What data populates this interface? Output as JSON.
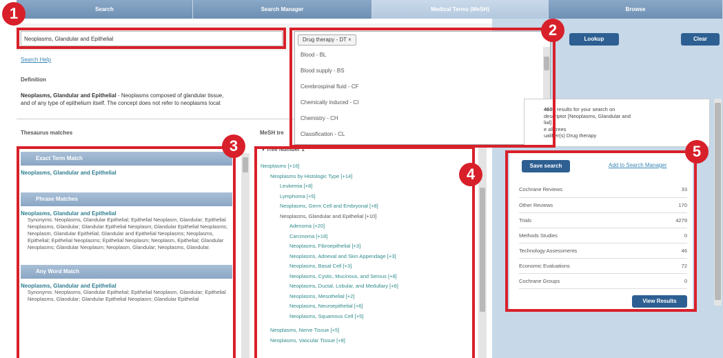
{
  "tabs": [
    {
      "label": "Search",
      "active": false
    },
    {
      "label": "Search Manager",
      "active": false
    },
    {
      "label": "Medical Terms (MeSH)",
      "active": true
    },
    {
      "label": "Browse",
      "active": false
    }
  ],
  "search": {
    "value": "Neoplasms, Glandular and Epithelial",
    "help_link": "Search Help",
    "lookup_label": "Lookup",
    "clear_label": "Clear"
  },
  "definition": {
    "heading": "Definition",
    "term": "Neoplasms, Glandular and Epithelial",
    "text_line1": " - Neoplasms composed of glandular tissue,",
    "text_line2": "and of any type of epithelium itself. The concept does not refer to neoplasms locat"
  },
  "thesaurus": {
    "heading": "Thesaurus matches",
    "sections": [
      {
        "title": "Exact Term Match",
        "matches": [
          {
            "title": "Neoplasms, Glandular and Epithelial",
            "text": ""
          }
        ]
      },
      {
        "title": "Phrase Matches",
        "matches": [
          {
            "title": "Neoplasms, Glandular and Epithelial",
            "text": "Synonyms: Neoplasms, Glandular Epithelial; Epithelial Neoplasm, Glandular; Epithelial Neoplasms, Glandular; Glandular Epithelial Neoplasm; Glandular Epithelial Neoplasms; Neoplasm, Glandular Epithelial; Glandular and Epithelial Neoplasms; Neoplasms, Epithelial; Epithelial Neoplasms; Epithelial Neoplasm; Neoplasm, Epithelial; Glandular Neoplasms; Glandular Neoplasm; Neoplasm, Glandular; Neoplasms, Glandular."
          }
        ]
      },
      {
        "title": "Any Word Match",
        "matches": [
          {
            "title": "Neoplasms, Glandular and Epithelial",
            "text": "Synonyms: Neoplasms, Glandular Epithelial; Epithelial Neoplasm, Glandular; Epithelial Neoplasms, Glandular; Glandular Epithelial Neoplasm; Glandular Epithelial"
          }
        ]
      }
    ]
  },
  "mesh_tree": {
    "heading": "MeSH tre",
    "tree_number_label": "Tree Number 1",
    "items": [
      {
        "label": "Neoplasms [+16]",
        "level": 0,
        "style": "link"
      },
      {
        "label": "Neoplasms by Histologic Type [+14]",
        "level": 1,
        "style": "link"
      },
      {
        "label": "Leukemia [+8]",
        "level": 2,
        "style": "link"
      },
      {
        "label": "Lymphoma [+5]",
        "level": 2,
        "style": "link"
      },
      {
        "label": "Neoplasms, Germ Cell and Embryonal [+8]",
        "level": 2,
        "style": "link"
      },
      {
        "label": "Neoplasms, Glandular and Epithelial [+10]",
        "level": 2,
        "style": "dark"
      },
      {
        "label": "Adenoma [+20]",
        "level": 3,
        "style": "link"
      },
      {
        "label": "Carcinoma [+18]",
        "level": 3,
        "style": "link"
      },
      {
        "label": "Neoplasms, Fibroepithelial [+3]",
        "level": 3,
        "style": "link"
      },
      {
        "label": "Neoplasms, Adnexal and Skin Appendage [+3]",
        "level": 3,
        "style": "link"
      },
      {
        "label": "Neoplasms, Basal Cell [+3]",
        "level": 3,
        "style": "link"
      },
      {
        "label": "Neoplasms, Cystic, Mucinous, and Serous [+8]",
        "level": 3,
        "style": "link"
      },
      {
        "label": "Neoplasms, Ductal, Lobular, and Medullary [+6]",
        "level": 3,
        "style": "link"
      },
      {
        "label": "Neoplasms, Mesothelial [+2]",
        "level": 3,
        "style": "link"
      },
      {
        "label": "Neoplasms, Neuroepithelial [+6]",
        "level": 3,
        "style": "link"
      },
      {
        "label": "Neoplasms, Squamous Cell [+5]",
        "level": 3,
        "style": "link"
      },
      {
        "label": "",
        "level": 0,
        "style": "spacer"
      },
      {
        "label": "Neoplasms, Nerve Tissue [+5]",
        "level": 1,
        "style": "link"
      },
      {
        "label": "Neoplasms, Vascular Tissue [+8]",
        "level": 1,
        "style": "link"
      }
    ]
  },
  "qualifier_dropdown": {
    "selected": "Drug therapy - DT",
    "options": [
      "Blood - BL",
      "Blood supply - BS",
      "Cerebrospinal fluid - CF",
      "Chemically induced - CI",
      "Chemistry - CH",
      "Classification - CL",
      "Complications - CO"
    ]
  },
  "results_info": {
    "line1_count": "4600",
    "line1": " results for your search on",
    "line2": "descriptor [Neoplasms, Glandular and",
    "line3": "lial]",
    "line4": "e all trees",
    "line5": "ualifier(s) Drug therapy"
  },
  "results_panel": {
    "save_label": "Save search",
    "add_link": "Add to Search Manager",
    "view_label": "View Results",
    "rows": [
      {
        "label": "Cochrane Reviews",
        "count": "33"
      },
      {
        "label": "Other Reviews",
        "count": "170"
      },
      {
        "label": "Trials",
        "count": "4279"
      },
      {
        "label": "Methods Studies",
        "count": "0"
      },
      {
        "label": "Technology Assessments",
        "count": "46"
      },
      {
        "label": "Economic Evaluations",
        "count": "72"
      },
      {
        "label": "Cochrane Groups",
        "count": "0"
      }
    ]
  },
  "badges": [
    "1",
    "2",
    "3",
    "4",
    "5"
  ],
  "colors": {
    "highlight": "#d8202a",
    "accent": "#2d5f92",
    "link": "#2e8a8a"
  }
}
